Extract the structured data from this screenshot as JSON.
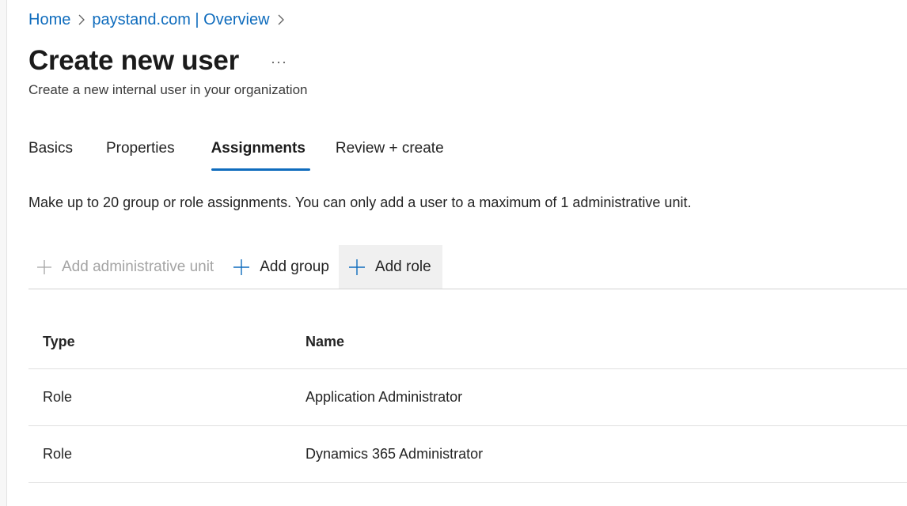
{
  "breadcrumb": {
    "items": [
      "Home",
      "paystand.com | Overview"
    ]
  },
  "page": {
    "title": "Create new user",
    "more": "...",
    "subtitle": "Create a new internal user in your organization"
  },
  "tabs": [
    {
      "label": "Basics",
      "active": false
    },
    {
      "label": "Properties",
      "active": false
    },
    {
      "label": "Assignments",
      "active": true
    },
    {
      "label": "Review + create",
      "active": false
    }
  ],
  "info_text": "Make up to 20 group or role assignments. You can only add a user to a maximum of 1 administrative unit.",
  "toolbar": {
    "add_admin_unit": {
      "label": "Add administrative unit",
      "disabled": true
    },
    "add_group": {
      "label": "Add group"
    },
    "add_role": {
      "label": "Add role"
    }
  },
  "table": {
    "columns": [
      "Type",
      "Name"
    ],
    "rows": [
      {
        "type": "Role",
        "name": "Application Administrator"
      },
      {
        "type": "Role",
        "name": "Dynamics 365 Administrator"
      }
    ]
  },
  "icons": {
    "plus": "plus-icon",
    "chevron": "chevron-right-icon",
    "more": "more-horizontal-icon"
  },
  "colors": {
    "accent": "#0f6cbd",
    "disabled_text": "#a4a4a4",
    "hover_bg": "#f0f0f0"
  }
}
